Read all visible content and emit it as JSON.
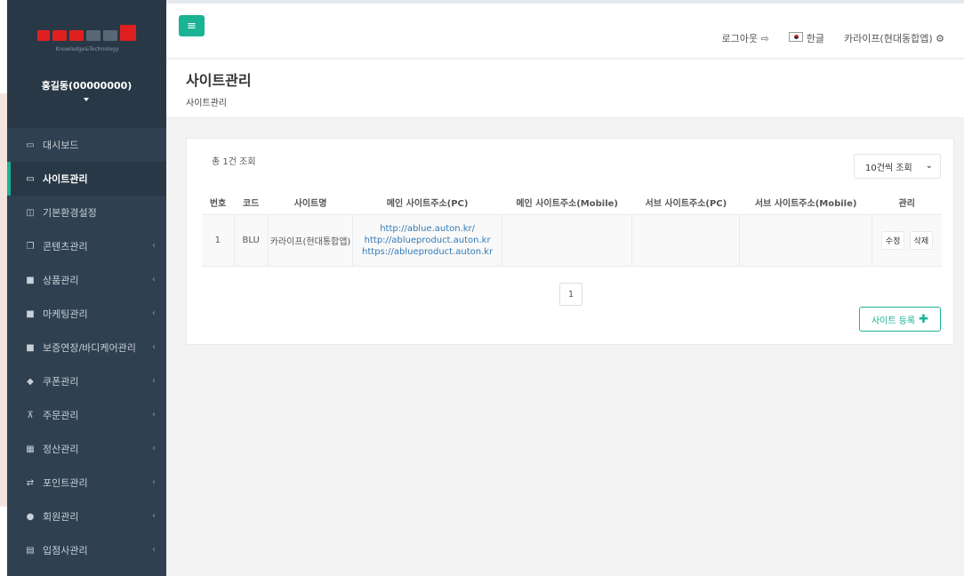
{
  "colors": {
    "accent": "#1ab394",
    "sidebar_bg": "#2f4050",
    "link": "#337ab7"
  },
  "sidebar": {
    "logo_sub": "Knowledge&Technology",
    "user_name": "홍길동(00000000)",
    "items": [
      {
        "label": "대시보드",
        "icon": "desktop-icon"
      },
      {
        "label": "사이트관리",
        "icon": "desktop-icon",
        "active": true
      },
      {
        "label": "기본환경설정",
        "icon": "columns-icon"
      },
      {
        "label": "콘텐츠관리",
        "icon": "files-icon",
        "chevron": "‹"
      },
      {
        "label": "상품관리",
        "icon": "archive-icon",
        "chevron": "‹"
      },
      {
        "label": "마케팅관리",
        "icon": "archive-icon",
        "chevron": "‹"
      },
      {
        "label": "보증연장/바디케어관리",
        "icon": "archive-icon",
        "chevron": "‹"
      },
      {
        "label": "쿠폰관리",
        "icon": "tag-icon",
        "chevron": "‹"
      },
      {
        "label": "주문관리",
        "icon": "cart-icon",
        "chevron": "‹"
      },
      {
        "label": "정산관리",
        "icon": "calculator-icon",
        "chevron": "‹"
      },
      {
        "label": "포인트관리",
        "icon": "exchange-icon",
        "chevron": "‹"
      },
      {
        "label": "회원관리",
        "icon": "user-icon",
        "chevron": "‹"
      },
      {
        "label": "입점사관리",
        "icon": "building-icon",
        "chevron": "‹"
      }
    ]
  },
  "topbar": {
    "menu_icon": "≡",
    "logout": "로그아웃",
    "logout_icon": "⇨",
    "language": "한글",
    "site_name": "카라이프(현대동합엡)",
    "gear_icon": "⚙"
  },
  "heading": {
    "title": "사이트관리",
    "breadcrumb": "사이트관리"
  },
  "panel": {
    "count_text": "총 1건 조회",
    "page_size": "10건씩 조회",
    "table": {
      "headers": [
        "번호",
        "코드",
        "사이트명",
        "메인 사이트주소(PC)",
        "메인 사이트주소(Mobile)",
        "서브 사이트주소(PC)",
        "서브 사이트주소(Mobile)",
        "관리"
      ],
      "rows": [
        {
          "no": "1",
          "code": "BLU",
          "name": "카라이프(현대통합앱)",
          "main_pc": [
            "http://ablue.auton.kr/",
            "http://ablueproduct.auton.kr",
            "https://ablueproduct.auton.kr"
          ],
          "main_mobile": "",
          "sub_pc": "",
          "sub_mobile": "",
          "edit": "수정",
          "delete": "삭제"
        }
      ]
    },
    "page": "1",
    "register_label": "사이트 등록",
    "register_icon": "✚"
  }
}
